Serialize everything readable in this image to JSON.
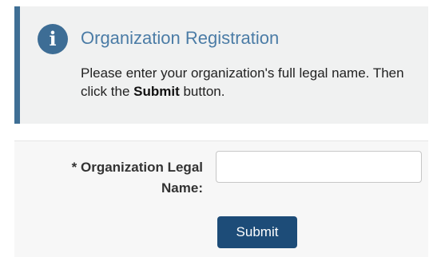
{
  "notice": {
    "icon": "info-circle-icon",
    "icon_glyph": "i",
    "title": "Organization Registration",
    "body_before": "Please enter your organization's full legal name. Then click the ",
    "body_bold": "Submit",
    "body_after": " button."
  },
  "form": {
    "field_label": "* Organization Legal Name:",
    "field_value": "",
    "field_placeholder": "",
    "submit_label": "Submit"
  },
  "colors": {
    "accent": "#3f6f95",
    "title": "#4b7ca6",
    "button": "#1d4c78",
    "notice_bg": "#f0f1f1"
  }
}
